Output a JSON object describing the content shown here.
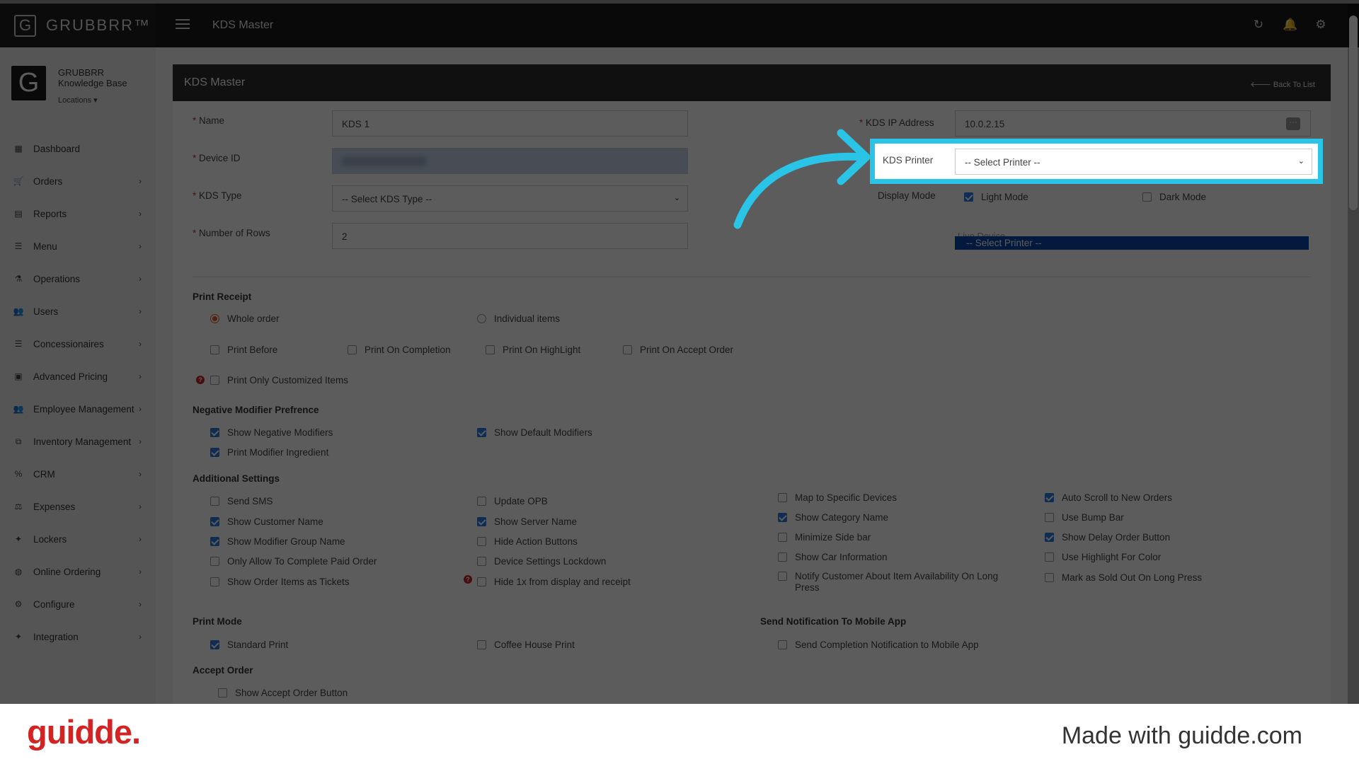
{
  "topbar": {
    "brand": "GRUBBRR™",
    "title": "KDS Master"
  },
  "icons": {
    "refresh": "refresh-icon",
    "bell": "bell-icon",
    "settings": "gear-icon"
  },
  "profile": {
    "logo_letter": "G",
    "name": "GRUBBRR Knowledge Base",
    "locations": "Locations ▾"
  },
  "nav": [
    {
      "icon": "▦",
      "label": "Dashboard",
      "chevron": ""
    },
    {
      "icon": "🛒",
      "label": "Orders",
      "chevron": "›"
    },
    {
      "icon": "▤",
      "label": "Reports",
      "chevron": "›"
    },
    {
      "icon": "☰",
      "label": "Menu",
      "chevron": "›"
    },
    {
      "icon": "⚗",
      "label": "Operations",
      "chevron": "›"
    },
    {
      "icon": "👥",
      "label": "Users",
      "chevron": "›"
    },
    {
      "icon": "☰",
      "label": "Concessionaires",
      "chevron": "›"
    },
    {
      "icon": "▣",
      "label": "Advanced Pricing",
      "chevron": "›"
    },
    {
      "icon": "👥",
      "label": "Employee Management",
      "chevron": "›"
    },
    {
      "icon": "⧉",
      "label": "Inventory Management",
      "chevron": "›"
    },
    {
      "icon": "%",
      "label": "CRM",
      "chevron": "›"
    },
    {
      "icon": "⚖",
      "label": "Expenses",
      "chevron": "›"
    },
    {
      "icon": "✦",
      "label": "Lockers",
      "chevron": "›"
    },
    {
      "icon": "◍",
      "label": "Online Ordering",
      "chevron": "›"
    },
    {
      "icon": "⚙",
      "label": "Configure",
      "chevron": "›"
    },
    {
      "icon": "✦",
      "label": "Integration",
      "chevron": "›"
    }
  ],
  "panel": {
    "title": "KDS Master",
    "back": "🡐 Back To List"
  },
  "form": {
    "name_label": "Name",
    "name_value": "KDS 1",
    "device_label": "Device ID",
    "kds_type_label": "KDS Type",
    "kds_type_value": "-- Select KDS Type --",
    "rows_label": "Number of Rows",
    "rows_value": "2",
    "ip_label": "KDS IP Address",
    "ip_value": "10.0.2.15",
    "printer_label": "KDS Printer",
    "printer_value": "-- Select Printer --",
    "display_label": "Display Mode",
    "light_mode": "Light Mode",
    "dark_mode": "Dark Mode",
    "live_device": "Live Device",
    "dropdown_option": "-- Select Printer --",
    "required_mark": "*",
    "dots": "···",
    "chevron": "⌄"
  },
  "print_receipt": {
    "title": "Print Receipt",
    "whole_order": "Whole order",
    "individual_items": "Individual items",
    "print_before": "Print Before",
    "print_on_completion": "Print On Completion",
    "print_on_highlight": "Print On HighLight",
    "print_on_accept": "Print On Accept Order",
    "print_only_customized": "Print Only Customized Items"
  },
  "negative_modifier": {
    "title": "Negative Modifier Prefrence",
    "show_negative": "Show Negative Modifiers",
    "show_default": "Show Default Modifiers",
    "print_modifier_ingredient": "Print Modifier Ingredient"
  },
  "additional": {
    "title": "Additional Settings",
    "items": {
      "send_sms": "Send SMS",
      "show_customer_name": "Show Customer Name",
      "show_modifier_group_name": "Show Modifier Group Name",
      "only_allow_paid": "Only Allow To Complete Paid Order",
      "show_order_items_tickets": "Show Order Items as Tickets",
      "update_opb": "Update OPB",
      "show_server_name": "Show Server Name",
      "hide_action_buttons": "Hide Action Buttons",
      "device_settings_lockdown": "Device Settings Lockdown",
      "hide_1x": "Hide 1x from display and receipt",
      "map_specific_devices": "Map to Specific Devices",
      "show_category_name": "Show Category Name",
      "minimize_side_bar": "Minimize Side bar",
      "show_car_information": "Show Car Information",
      "notify_customer": "Notify Customer About Item Availability On Long Press",
      "auto_scroll": "Auto Scroll to New Orders",
      "use_bump_bar": "Use Bump Bar",
      "show_delay_order": "Show Delay Order Button",
      "use_highlight_color": "Use Highlight For Color",
      "mark_sold_out": "Mark as Sold Out On Long Press"
    }
  },
  "print_mode": {
    "title": "Print Mode",
    "standard": "Standard Print",
    "coffee_house": "Coffee House Print"
  },
  "notification": {
    "title": "Send Notification To Mobile App",
    "completion": "Send Completion Notification to Mobile App"
  },
  "accept_order": {
    "title": "Accept Order",
    "show_button": "Show Accept Order Button"
  },
  "help_mark": "?",
  "footer": {
    "logo": "guidde.",
    "tagline": "Made with guidde.com"
  },
  "colors": {
    "highlight": "#29c4e6",
    "checkbox": "#2a7ae2",
    "radio": "#e85c2c",
    "guidde_red": "#d32323"
  }
}
